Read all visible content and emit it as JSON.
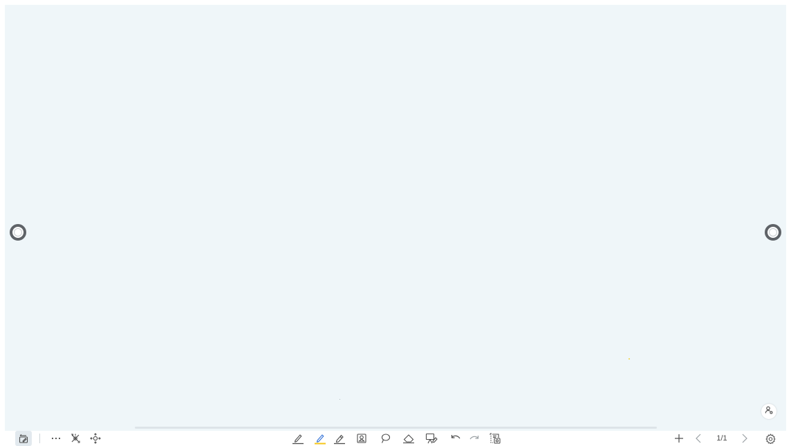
{
  "canvas": {
    "background": "#eff6f9"
  },
  "page_indicator": {
    "text": "1/1"
  },
  "icons": {
    "left_handle": "ring-handle-icon",
    "right_handle": "ring-handle-icon",
    "user": "user-icon",
    "whiteboard_mode": "whiteboard-edit-icon",
    "more": "more-dots-icon",
    "tools": "tools-icon",
    "move": "move-arrows-icon",
    "pen": "pen-icon",
    "highlighter": "highlighter-icon",
    "marker": "marker-icon",
    "shape": "shape-icon",
    "lasso": "lasso-icon",
    "eraser": "eraser-icon",
    "board_clear": "clear-board-icon",
    "undo": "undo-icon",
    "redo": "redo-icon",
    "screenshot": "screenshot-icon",
    "add_page": "plus-icon",
    "prev_page": "chevron-left-icon",
    "next_page": "chevron-right-icon",
    "settings": "gear-icon"
  },
  "colors": {
    "accent_selected": "#f5c518",
    "icon": "#4a4a4a",
    "handle_ring": "#5f6368"
  }
}
